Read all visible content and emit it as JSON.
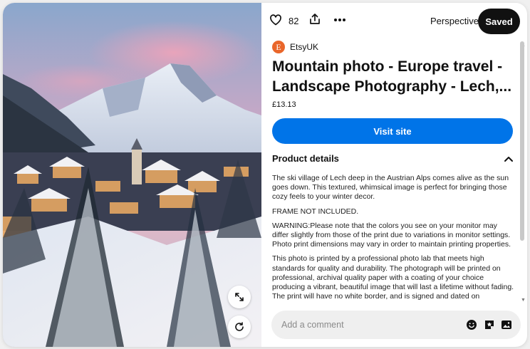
{
  "actions": {
    "like_count": "82",
    "board_name": "Perspective",
    "saved_label": "Saved",
    "icons": [
      "heart-icon",
      "share-icon",
      "more-icon"
    ]
  },
  "image": {
    "description_icons": [
      "expand-icon",
      "visual-search-icon"
    ]
  },
  "pin": {
    "source": "EtsyUK",
    "source_logo_letter": "E",
    "title_line1": "Mountain photo - Europe travel -",
    "title_line2": "Landscape Photography - Lech,...",
    "price": "£13.13",
    "visit_label": "Visit site"
  },
  "details": {
    "header": "Product details",
    "paragraphs": [
      "The ski village of Lech deep in the Austrian Alps comes alive as the sun goes down. This textured, whimsical image is perfect for bringing those cozy feels to your winter decor.",
      "FRAME NOT INCLUDED.",
      "WARNING:Please note that the colors you see on your monitor may differ slightly from those of the print due to variations in monitor settings. Photo print dimensions may vary in order to maintain printing properties.",
      "This photo is printed by a professional photo lab that meets high standards for quality and durability. The photograph will be printed on professional, archival quality paper with a coating of your choice producing a vibrant, beautiful image that will last a lifetime without fading. The print will have no white border, and is signed and dated on"
    ]
  },
  "comment": {
    "placeholder": "Add a comment"
  },
  "colors": {
    "primary_button": "#0074e8",
    "saved_button": "#111111",
    "source_logo": "#e9662a",
    "comment_bg": "#efefef"
  }
}
